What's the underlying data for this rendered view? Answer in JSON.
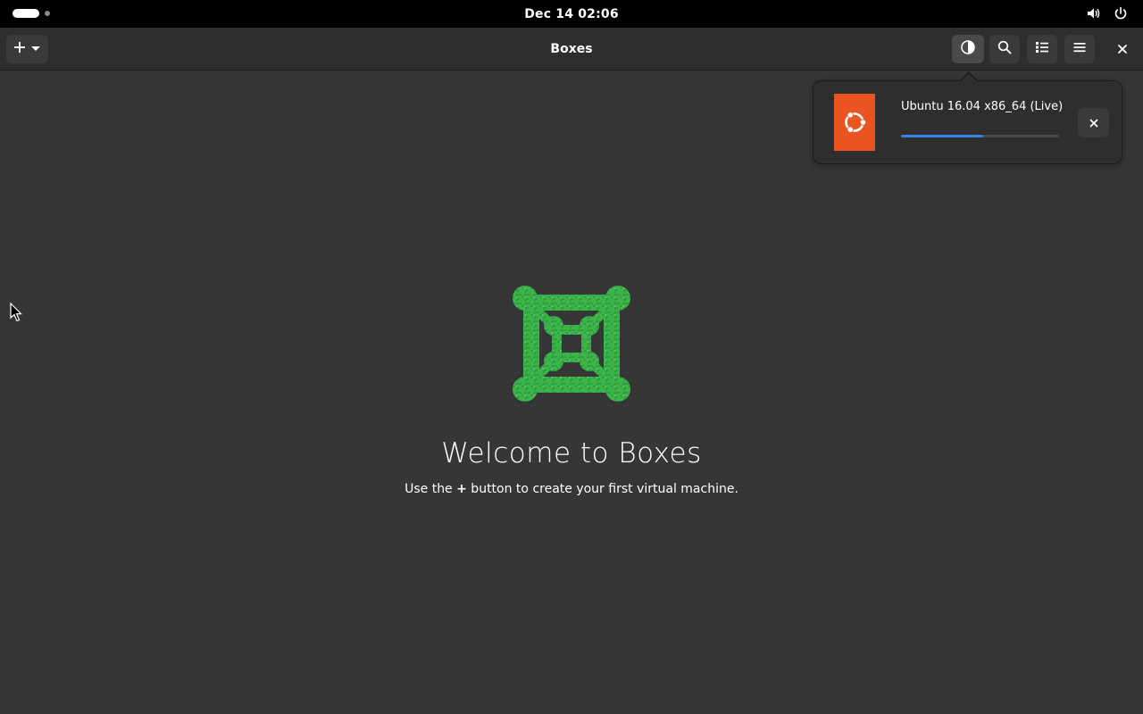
{
  "topbar": {
    "clock": "Dec 14  02:06",
    "icons": [
      "volume-icon",
      "power-icon"
    ]
  },
  "headerbar": {
    "title": "Boxes",
    "buttons": [
      "add-icon",
      "dropdown-icon",
      "theme-icon",
      "search-icon",
      "list-view-icon",
      "hamburger-menu-icon",
      "close-icon"
    ]
  },
  "download": {
    "vm_name": "Ubuntu 16.04 x86_64 (Live)",
    "progress": 0.52,
    "logo_color": "#e95420",
    "progress_color": "#3584e4"
  },
  "empty_state": {
    "title": "Welcome to Boxes",
    "desc_before": "Use the ",
    "desc_plus": "+",
    "desc_after": " button to create your first virtual machine.",
    "logo_color": "#3bb54a"
  }
}
